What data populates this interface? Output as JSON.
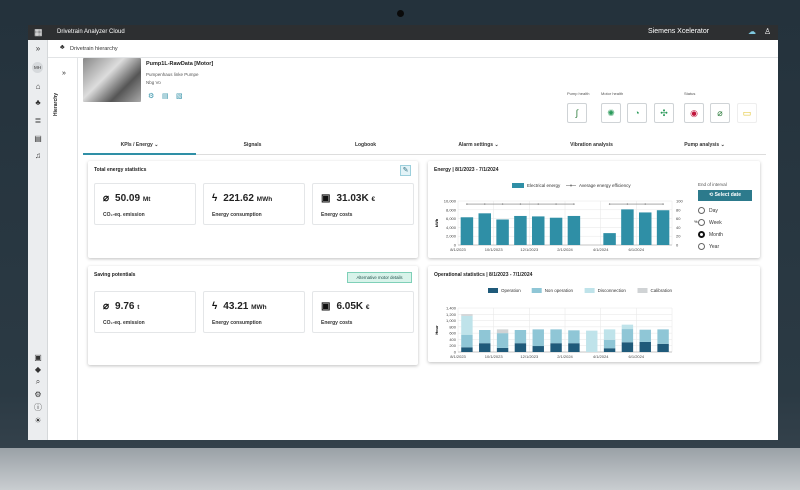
{
  "app": {
    "title": "Drivetrain Analyzer Cloud",
    "brand": "Siemens Xcelerator",
    "user_initials": "MH"
  },
  "breadcrumb": "Drivetrain hierarchy",
  "hierarchy_label": "Hierarchy",
  "asset": {
    "name": "Pump1L-RawData [Motor]",
    "location": "Pumpenhaus linke Pumpe",
    "sub": "Nbg Vo"
  },
  "status_groups": {
    "pump_health": "Pump health",
    "motor_health": "Motor health",
    "status": "Status"
  },
  "tabs": [
    {
      "label": "KPIs / Energy ⌄",
      "active": true
    },
    {
      "label": "Signals"
    },
    {
      "label": "Logbook"
    },
    {
      "label": "Alarm settings ⌄"
    },
    {
      "label": "Vibration analysis"
    },
    {
      "label": "Pump analysis ⌄"
    }
  ],
  "total": {
    "title": "Total energy statistics",
    "items": [
      {
        "icon": "leaf-icon",
        "value": "50.09",
        "unit": "Mt",
        "label": "CO₂-eq. emission"
      },
      {
        "icon": "lightning-icon",
        "value": "221.62",
        "unit": "MWh",
        "label": "Energy consumption"
      },
      {
        "icon": "money-icon",
        "value": "31.03K",
        "unit": "€",
        "label": "Energy costs"
      }
    ]
  },
  "saving": {
    "title": "Saving potentials",
    "button": "Alternative motor details",
    "items": [
      {
        "icon": "leaf-icon",
        "value": "9.76",
        "unit": "t",
        "label": "CO₂-eq. emission"
      },
      {
        "icon": "lightning-icon",
        "value": "43.21",
        "unit": "MWh",
        "label": "Energy consumption"
      },
      {
        "icon": "money-icon",
        "value": "6.05K",
        "unit": "€",
        "label": "Energy costs"
      }
    ]
  },
  "interval": {
    "label": "End of interval",
    "button": "Select date",
    "options": [
      "Day",
      "Week",
      "Month",
      "Year"
    ],
    "selected": "Month"
  },
  "colors": {
    "accent": "#2f8fa6",
    "operation": "#1f5a7a",
    "non_operation": "#8fc6d6",
    "disconnection": "#bfe3ea",
    "calibration": "#d0d3d5"
  },
  "chart_data": [
    {
      "type": "bar",
      "title": "Energy | 8/1/2023 - 7/1/2024",
      "categories": [
        "8/1/2023",
        "9/1/2023",
        "10/1/2023",
        "11/1/2023",
        "12/1/2023",
        "1/1/2024",
        "2/1/2024",
        "3/1/2024",
        "4/1/2024",
        "5/1/2024",
        "6/1/2024",
        "7/1/2024"
      ],
      "tick_labels": [
        "8/1/2023",
        "10/1/2023",
        "12/1/2023",
        "2/1/2024",
        "4/1/2024",
        "6/1/2024"
      ],
      "series": [
        {
          "name": "Electrical energy",
          "values": [
            6300,
            7200,
            5800,
            6600,
            6500,
            6200,
            6600,
            0,
            2700,
            8100,
            7400,
            7900
          ]
        },
        {
          "name": "Average energy efficiency",
          "values": [
            93,
            93,
            93,
            93,
            93,
            93,
            93,
            null,
            93,
            93,
            93,
            93
          ],
          "axis": "right"
        }
      ],
      "ylabel": "kWh",
      "ylim": [
        0,
        10000
      ],
      "yticks": [
        "0",
        "2,000",
        "4,000",
        "6,000",
        "8,000",
        "10,000"
      ],
      "y2label": "%",
      "y2lim": [
        0,
        100
      ],
      "y2ticks": [
        "0",
        "20",
        "40",
        "60",
        "80",
        "100"
      ],
      "legend": "top",
      "grid": true
    },
    {
      "type": "bar",
      "stacked": true,
      "title": "Operational statistics | 8/1/2023 - 7/1/2024",
      "categories": [
        "8/1/2023",
        "9/1/2023",
        "10/1/2023",
        "11/1/2023",
        "12/1/2023",
        "1/1/2024",
        "2/1/2024",
        "3/1/2024",
        "4/1/2024",
        "5/1/2024",
        "6/1/2024",
        "7/1/2024"
      ],
      "tick_labels": [
        "8/1/2023",
        "10/1/2023",
        "12/1/2023",
        "2/1/2024",
        "4/1/2024",
        "6/1/2024"
      ],
      "series": [
        {
          "name": "Operation",
          "values": [
            150,
            280,
            130,
            280,
            190,
            280,
            280,
            0,
            120,
            310,
            320,
            260
          ]
        },
        {
          "name": "Non operation",
          "values": [
            400,
            420,
            470,
            420,
            530,
            440,
            410,
            0,
            270,
            420,
            390,
            460
          ]
        },
        {
          "name": "Disconnection",
          "values": [
            600,
            0,
            0,
            0,
            0,
            0,
            0,
            680,
            330,
            140,
            0,
            0
          ]
        },
        {
          "name": "Calibration",
          "values": [
            50,
            0,
            120,
            0,
            0,
            0,
            0,
            0,
            0,
            0,
            0,
            0
          ]
        }
      ],
      "ylabel": "Hour",
      "ylim": [
        0,
        1400
      ],
      "yticks": [
        "0",
        "200",
        "400",
        "600",
        "800",
        "1,000",
        "1,200",
        "1,400"
      ],
      "legend": "top",
      "grid": true
    }
  ]
}
